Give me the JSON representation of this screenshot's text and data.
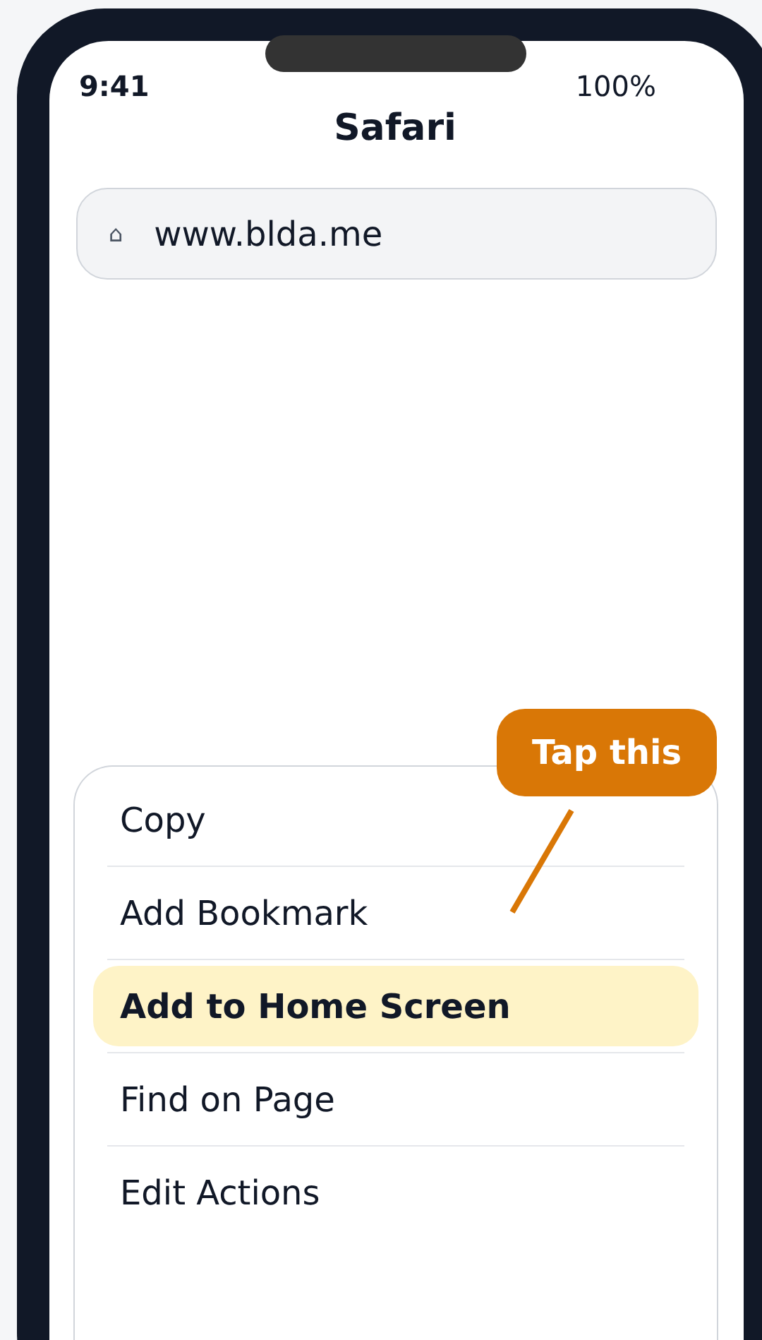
{
  "status_bar": {
    "time": "9:41",
    "battery": "100%"
  },
  "title": "Safari",
  "address_bar": {
    "icon": "⌂",
    "value": "www.blda.me"
  },
  "menu": {
    "items": [
      {
        "label": "Copy",
        "selected": false
      },
      {
        "label": "Add Bookmark",
        "selected": false
      },
      {
        "label": "Add to Home Screen",
        "selected": true
      },
      {
        "label": "Find on Page",
        "selected": false
      },
      {
        "label": "Edit Actions",
        "selected": false
      }
    ]
  },
  "callout": {
    "text": "Tap this"
  }
}
